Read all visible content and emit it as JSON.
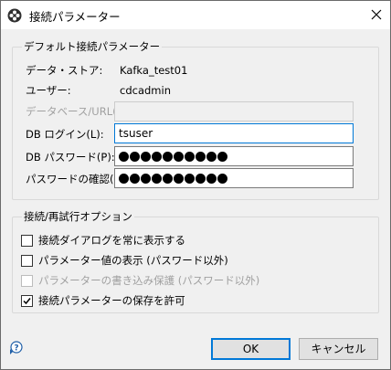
{
  "window": {
    "title": "接続パラメーター"
  },
  "default_group": {
    "title": "デフォルト接続パラメーター",
    "datastore_label": "データ・ストア:",
    "datastore_value": "Kafka_test01",
    "user_label": "ユーザー:",
    "user_value": "cdcadmin",
    "database_url_label": "データベース/URL(D):",
    "database_url_value": "",
    "db_login_label": "DB ログイン(L):",
    "db_login_value": "tsuser",
    "db_password_label": "DB パスワード(P):",
    "db_password_mask_count": 10,
    "confirm_password_label": "パスワードの確認(C):",
    "confirm_password_mask_count": 10
  },
  "retry_group": {
    "title": "接続/再試行オプション",
    "options": [
      {
        "label": "接続ダイアログを常に表示する",
        "checked": false,
        "disabled": false
      },
      {
        "label": "パラメーター値の表示 (パスワード以外)",
        "checked": false,
        "disabled": false
      },
      {
        "label": "パラメーターの書き込み保護 (パスワード以外)",
        "checked": false,
        "disabled": true
      },
      {
        "label": "接続パラメーターの保存を許可",
        "checked": true,
        "disabled": false
      }
    ]
  },
  "buttons": {
    "ok": "OK",
    "cancel": "キャンセル"
  },
  "icons": {
    "app": "connection-icon",
    "close": "close-icon",
    "help": "help-icon"
  }
}
